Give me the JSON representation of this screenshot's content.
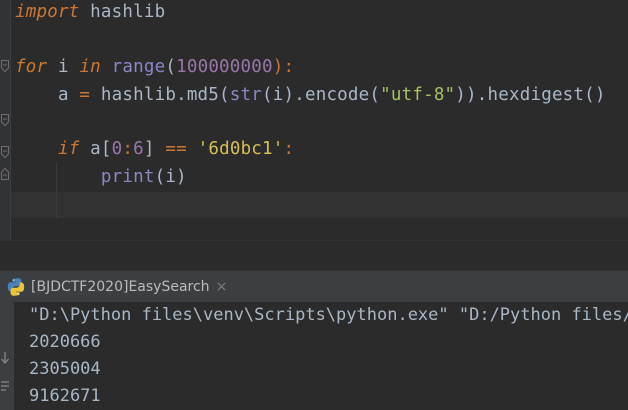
{
  "editor": {
    "lines": [
      {
        "id": "l1",
        "tokens": [
          {
            "t": "import",
            "c": "kw"
          },
          {
            "t": " hashlib",
            "c": "punct"
          }
        ]
      },
      {
        "id": "l2",
        "tokens": []
      },
      {
        "id": "l3",
        "tokens": [
          {
            "t": "for",
            "c": "kw"
          },
          {
            "t": " i ",
            "c": "punct"
          },
          {
            "t": "in",
            "c": "kw"
          },
          {
            "t": " ",
            "c": "punct"
          },
          {
            "t": "range",
            "c": "fn"
          },
          {
            "t": "(",
            "c": "punct"
          },
          {
            "t": "100000000",
            "c": "num-purple"
          },
          {
            "t": "):",
            "c": "op"
          }
        ]
      },
      {
        "id": "l4",
        "tokens": [
          {
            "t": "    a ",
            "c": "punct"
          },
          {
            "t": "=",
            "c": "op"
          },
          {
            "t": " hashlib",
            "c": "punct"
          },
          {
            "t": ".",
            "c": "punct"
          },
          {
            "t": "md5",
            "c": "call"
          },
          {
            "t": "(",
            "c": "punct"
          },
          {
            "t": "str",
            "c": "fn"
          },
          {
            "t": "(i)",
            "c": "punct"
          },
          {
            "t": ".",
            "c": "punct"
          },
          {
            "t": "encode",
            "c": "call"
          },
          {
            "t": "(",
            "c": "punct"
          },
          {
            "t": "\"utf-8\"",
            "c": "strq"
          },
          {
            "t": "))",
            "c": "punct"
          },
          {
            "t": ".",
            "c": "punct"
          },
          {
            "t": "hexdigest",
            "c": "call"
          },
          {
            "t": "()",
            "c": "punct"
          }
        ]
      },
      {
        "id": "l5",
        "tokens": []
      },
      {
        "id": "l6",
        "tokens": [
          {
            "t": "    ",
            "c": "punct"
          },
          {
            "t": "if",
            "c": "kw"
          },
          {
            "t": " a[",
            "c": "punct"
          },
          {
            "t": "0",
            "c": "num-purple"
          },
          {
            "t": ":",
            "c": "op"
          },
          {
            "t": "6",
            "c": "num-purple"
          },
          {
            "t": "] ",
            "c": "punct"
          },
          {
            "t": "==",
            "c": "op"
          },
          {
            "t": " ",
            "c": "punct"
          },
          {
            "t": "'6d0bc1'",
            "c": "str-sq"
          },
          {
            "t": ":",
            "c": "op"
          }
        ]
      },
      {
        "id": "l7",
        "tokens": [
          {
            "t": "        ",
            "c": "punct"
          },
          {
            "t": "print",
            "c": "fn"
          },
          {
            "t": "(i)",
            "c": "punct"
          }
        ]
      }
    ]
  },
  "run": {
    "tab_label": "[BJDCTF2020]EasySearch",
    "close_glyph": "×",
    "output": [
      "\"D:\\Python files\\venv\\Scripts\\python.exe\" \"D:/Python files/",
      "2020666",
      "2305004",
      "9162671"
    ]
  },
  "colors": {
    "editor_bg": "#2b2b2b",
    "keyword": "#cc7832",
    "number": "#9876aa",
    "string": "#a5c261",
    "builtin": "#8888c6",
    "text": "#a9b7c6"
  }
}
